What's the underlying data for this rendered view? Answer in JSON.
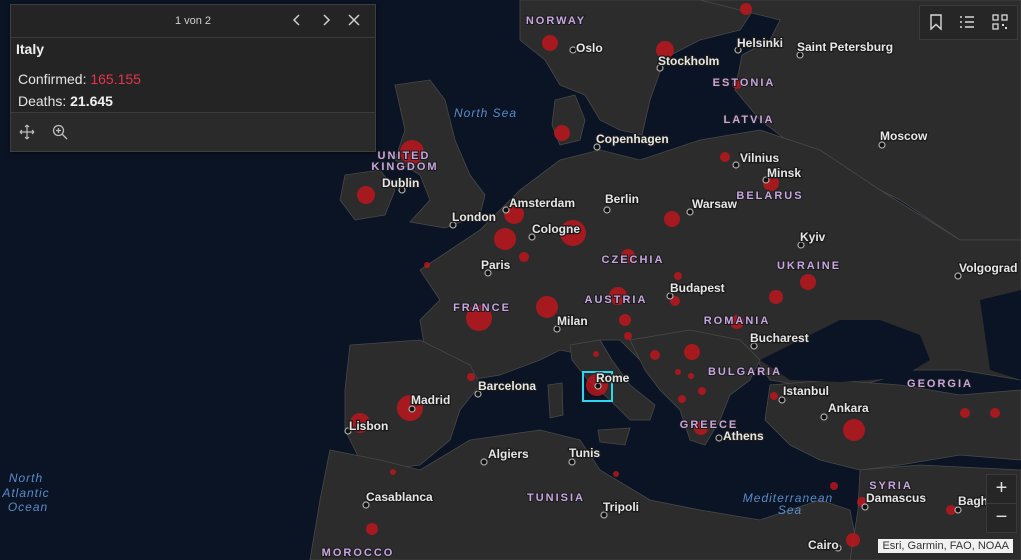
{
  "popup": {
    "pager": "1 von 2",
    "title": "Italy",
    "confirmed_label": "Confirmed:",
    "confirmed_value": "165.155",
    "deaths_label": "Deaths:",
    "deaths_value": "21.645"
  },
  "attribution": "Esri, Garmin, FAO, NOAA",
  "zoom": {
    "in": "+",
    "out": "−"
  },
  "colors": {
    "case_marker": "#c8141c",
    "selection": "#2fd6f0",
    "confirmed_text": "#e8334a",
    "land": "#2c2c2c",
    "water": "#0b1424"
  },
  "labels": {
    "water": [
      "North Sea",
      "North",
      "Atlantic",
      "Ocean",
      "Mediterranean",
      "Sea"
    ],
    "countries": [
      "NORWAY",
      "ESTONIA",
      "LATVIA",
      "UNITED",
      "KINGDOM",
      "BELARUS",
      "CZECHIA",
      "UKRAINE",
      "FRANCE",
      "AUSTRIA",
      "ROMANIA",
      "BULGARIA",
      "GEORGIA",
      "GREECE",
      "TUNISIA",
      "SYRIA",
      "MOROCCO"
    ],
    "cities": [
      "Oslo",
      "Helsinki",
      "Saint Petersburg",
      "Stockholm",
      "Copenhagen",
      "Moscow",
      "Vilnius",
      "Minsk",
      "Dublin",
      "Amsterdam",
      "Berlin",
      "London",
      "Cologne",
      "Warsaw",
      "Kyiv",
      "Paris",
      "Volgograd",
      "Budapest",
      "Milan",
      "Bucharest",
      "Rome",
      "Barcelona",
      "Istanbul",
      "Madrid",
      "Ankara",
      "Lisbon",
      "Athens",
      "Algiers",
      "Tunis",
      "Casablanca",
      "Tripoli",
      "Damascus",
      "Bagh",
      "Cairo"
    ]
  }
}
